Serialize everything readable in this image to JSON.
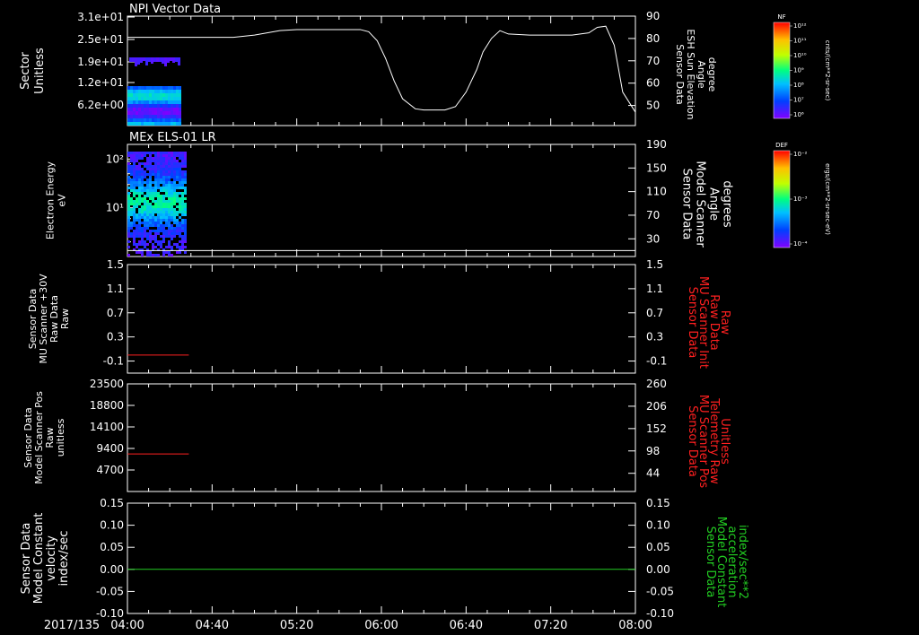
{
  "colors": {
    "white": "#ffffff",
    "red": "#ff2020",
    "green": "#22cc22"
  },
  "xaxis": {
    "date": "2017/135",
    "ticks": [
      "04:00",
      "04:40",
      "05:20",
      "06:00",
      "06:40",
      "07:20",
      "08:00"
    ],
    "range_min": [
      240,
      480
    ]
  },
  "colorbars": [
    {
      "title": "NF",
      "unit": "cnts/(cm**2-sr-sec)",
      "labels": [
        "10¹²",
        "10¹¹",
        "10¹⁰",
        "10⁹",
        "10⁸",
        "10⁷",
        "10⁶"
      ]
    },
    {
      "title": "DEF",
      "unit": "ergs/(cm**2-sr-sec-eV)",
      "labels": [
        "10⁻²",
        "10⁻³",
        "10⁻⁴"
      ]
    }
  ],
  "chart_data": [
    {
      "type": "heatmap",
      "title": "NPI Vector Data",
      "ylabel": [
        "Sector",
        "Unitless"
      ],
      "yticks": [
        "3.1e+01",
        "2.5e+01",
        "1.9e+01",
        "1.2e+01",
        "6.2e+00"
      ],
      "ylim": [
        0,
        31
      ],
      "data_x_range": [
        240,
        265
      ],
      "right_axis": {
        "label": [
          "Sensor Data",
          "ESH Sun Elevation",
          "Angle",
          "degree"
        ],
        "ticks": [
          90,
          80,
          70,
          60,
          50
        ],
        "ylim": [
          41,
          90
        ],
        "line": {
          "x": [
            240,
            265,
            280,
            290,
            300,
            312,
            320,
            335,
            350,
            354,
            358,
            362,
            366,
            370,
            376,
            380,
            385,
            390,
            395,
            400,
            405,
            408,
            412,
            416,
            420,
            430,
            440,
            450,
            458,
            462,
            466,
            470,
            474,
            480
          ],
          "y": [
            80.5,
            80.5,
            80.5,
            80.5,
            81.5,
            83.5,
            84,
            84,
            84,
            83,
            79,
            71,
            61,
            53,
            48.5,
            48,
            48,
            48,
            49.5,
            56,
            66,
            74,
            80,
            83.5,
            82,
            81.5,
            81.5,
            81.5,
            82.5,
            85,
            85.5,
            77,
            56,
            47
          ]
        }
      }
    },
    {
      "type": "heatmap",
      "title": "MEx ELS-01 LR",
      "ylabel": [
        "Electron Energy",
        "eV"
      ],
      "yticks": [
        "10²",
        "10¹"
      ],
      "ylog": true,
      "ylim": [
        1,
        200
      ],
      "data_x_range": [
        240,
        267
      ],
      "right_axis": {
        "label": [
          "Sensor Data",
          "Model Scanner",
          "Angle",
          "degrees"
        ],
        "ticks": [
          190,
          150,
          110,
          70,
          30
        ],
        "ylim": [
          0,
          190
        ],
        "line": {
          "x": [
            240,
            480
          ],
          "y": [
            10,
            10
          ]
        }
      }
    },
    {
      "type": "line",
      "ylabel": [
        "Sensor Data",
        "MU Scanner +30V",
        "Raw Data",
        "Raw"
      ],
      "yticks": [
        1.5,
        1.1,
        0.7,
        0.3,
        -0.1
      ],
      "ylim": [
        -0.3,
        1.5
      ],
      "series": [
        {
          "x": [
            240,
            269
          ],
          "y": [
            0.0,
            0.0
          ]
        }
      ],
      "right_axis": {
        "label": [
          "Sensor Data",
          "MU Scanner Init",
          "Raw Data",
          "Raw"
        ],
        "ticks": [
          1.5,
          1.1,
          0.7,
          0.3,
          -0.1
        ],
        "ylim": [
          -0.3,
          1.5
        ]
      }
    },
    {
      "type": "line",
      "ylabel": [
        "Sensor Data",
        "Model Scanner Pos",
        "Raw",
        "unitless"
      ],
      "yticks": [
        23500,
        18800,
        14100,
        9400,
        4700
      ],
      "ylim": [
        0,
        23500
      ],
      "series": [
        {
          "x": [
            240,
            269
          ],
          "y": [
            8200,
            8200
          ]
        }
      ],
      "right_axis": {
        "label": [
          "Sensor Data",
          "MU Scanner Pos",
          "Telemetry Raw",
          "Unitless"
        ],
        "ticks": [
          260,
          206,
          152,
          98,
          44
        ],
        "ylim": [
          0,
          260
        ]
      }
    },
    {
      "type": "line",
      "ylabel": [
        "Sensor Data",
        "Model Constant",
        "velocity",
        "index/sec"
      ],
      "yticks": [
        "0.15",
        "0.10",
        "0.05",
        "0.00",
        "-0.05",
        "-0.10"
      ],
      "ylim": [
        -0.1,
        0.15
      ],
      "series": [
        {
          "x": [
            240,
            480
          ],
          "y": [
            0.0,
            0.0
          ]
        }
      ],
      "right_axis": {
        "label": [
          "Sensor Data",
          "Model Constant",
          "acceleration",
          "index/sec**2"
        ],
        "ticks": [
          "0.15",
          "0.10",
          "0.05",
          "0.00",
          "-0.05",
          "-0.10"
        ],
        "ylim": [
          -0.1,
          0.15
        ]
      }
    }
  ]
}
